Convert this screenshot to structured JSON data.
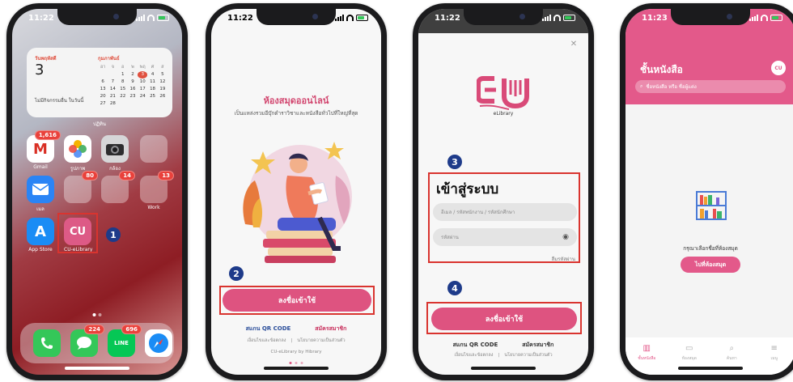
{
  "phone1": {
    "time": "11:22",
    "widget": {
      "weekday": "วันพฤหัสดี",
      "day": "3",
      "note": "ไม่มีกิจกรรมอื่น ในวันนี้",
      "month": "กุมภาพันธ์",
      "week_header": [
        "อา",
        "จ",
        "อ",
        "พ",
        "พฤ",
        "ศ",
        "ส"
      ],
      "weeks": [
        [
          "",
          "",
          "1",
          "2",
          "3",
          "4",
          "5"
        ],
        [
          "6",
          "7",
          "8",
          "9",
          "10",
          "11",
          "12"
        ],
        [
          "13",
          "14",
          "15",
          "16",
          "17",
          "18",
          "19"
        ],
        [
          "20",
          "21",
          "22",
          "23",
          "24",
          "25",
          "26"
        ],
        [
          "27",
          "28",
          "",
          "",
          "",
          "",
          ""
        ]
      ],
      "caption": "ปฏิทิน"
    },
    "apps": {
      "gmail": {
        "label": "Gmail",
        "badge": "1,616",
        "glyph": "M"
      },
      "photos": {
        "label": "รูปภาพ"
      },
      "camera": {
        "label": "กล้อง"
      },
      "folder_top": {
        "label": ""
      },
      "mail": {
        "label": "เมล"
      },
      "folder_a": {
        "label": "",
        "badge": "80"
      },
      "folder_b": {
        "label": "",
        "badge": "14"
      },
      "work": {
        "label": "Work",
        "badge": "13"
      },
      "app_store": {
        "label": "App Store",
        "glyph": "A"
      },
      "cu_elibrary": {
        "label": "CU-eLibrary",
        "glyph": "CU"
      }
    },
    "step": "1",
    "dock": {
      "messages_badge": "224",
      "line_badge": "696",
      "line_glyph": "LINE"
    }
  },
  "phone2": {
    "time": "11:22",
    "title": "ห้องสมุดออนไลน์",
    "subtitle": "เป็นแหล่งรวมอีบุ๊กตำราวิชาและหนังสือทั่วไปที่ใหญ่ที่สุด",
    "step": "2",
    "login_button": "ลงชื่อเข้าใช้",
    "scan_qr": "สแกน QR CODE",
    "register": "สมัครสมาชิก",
    "small_link_1": "เงื่อนไขและข้อตกลง",
    "small_separator": "|",
    "small_link_2": "นโยบายความเป็นส่วนตัว",
    "footer": "CU-eLibrary by Hibrary"
  },
  "phone3": {
    "time": "11:22",
    "logo_caption": "eLibrary",
    "step_3": "3",
    "title": "เข้าสู่ระบบ",
    "username_placeholder": "อีเมล / รหัสพนักงาน / รหัสนักศึกษา",
    "password_placeholder": "รหัสผ่าน",
    "forgot": "ลืมรหัสผ่าน",
    "step_4": "4",
    "login_button": "ลงชื่อเข้าใช้",
    "scan_qr": "สแกน QR CODE",
    "register": "สมัครสมาชิก",
    "small_link_1": "เงื่อนไขและข้อตกลง",
    "small_separator": "|",
    "small_link_2": "นโยบายความเป็นส่วนตัว"
  },
  "phone4": {
    "time": "11:23",
    "title": "ชั้นหนังสือ",
    "header_icon": "CU",
    "search_placeholder": "ชื่อหนังสือ หรือ ชื่อผู้แต่ง",
    "empty_message": "กรุณาเลือกชื่อที่ห้องสมุด",
    "go_library_button": "ไปที่ห้องสมุด",
    "tabs": [
      {
        "label": "ชั้นหนังสือ",
        "icon": "shelf-icon"
      },
      {
        "label": "ห้องสมุด",
        "icon": "library-icon"
      },
      {
        "label": "ค้นหา",
        "icon": "search-icon"
      },
      {
        "label": "เมนู",
        "icon": "menu-icon"
      }
    ]
  },
  "colors": {
    "brand_pink": "#de5380",
    "highlight_red": "#d9342f",
    "step_blue": "#1e3b8a",
    "link_blue": "#2b4e9a"
  }
}
